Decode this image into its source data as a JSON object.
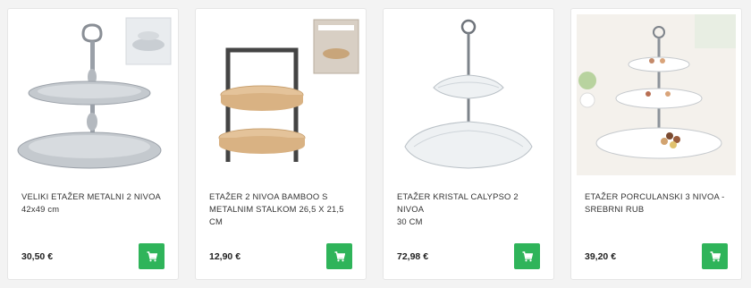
{
  "colors": {
    "accent": "#2fb45a",
    "background": "#f3f3f3",
    "card": "#ffffff"
  },
  "products": [
    {
      "title": "VELIKI ETAŽER METALNI 2 NIVOA",
      "subtitle": "42x49 cm",
      "price": "30,50 €",
      "cart_icon": "cart-icon"
    },
    {
      "title": "ETAŽER 2 NIVOA BAMBOO S METALNIM STALKOM 26,5 x 21,5 CM",
      "subtitle": "",
      "price": "12,90 €",
      "cart_icon": "cart-icon"
    },
    {
      "title": "ETAŽER KRISTAL CALYPSO 2 NIVOA",
      "subtitle": "30 CM",
      "price": "72,98 €",
      "cart_icon": "cart-icon"
    },
    {
      "title": "ETAŽER PORCULANSKI 3 NIVOA - SREBRNI RUB",
      "subtitle": "",
      "price": "39,20 €",
      "cart_icon": "cart-icon"
    }
  ]
}
